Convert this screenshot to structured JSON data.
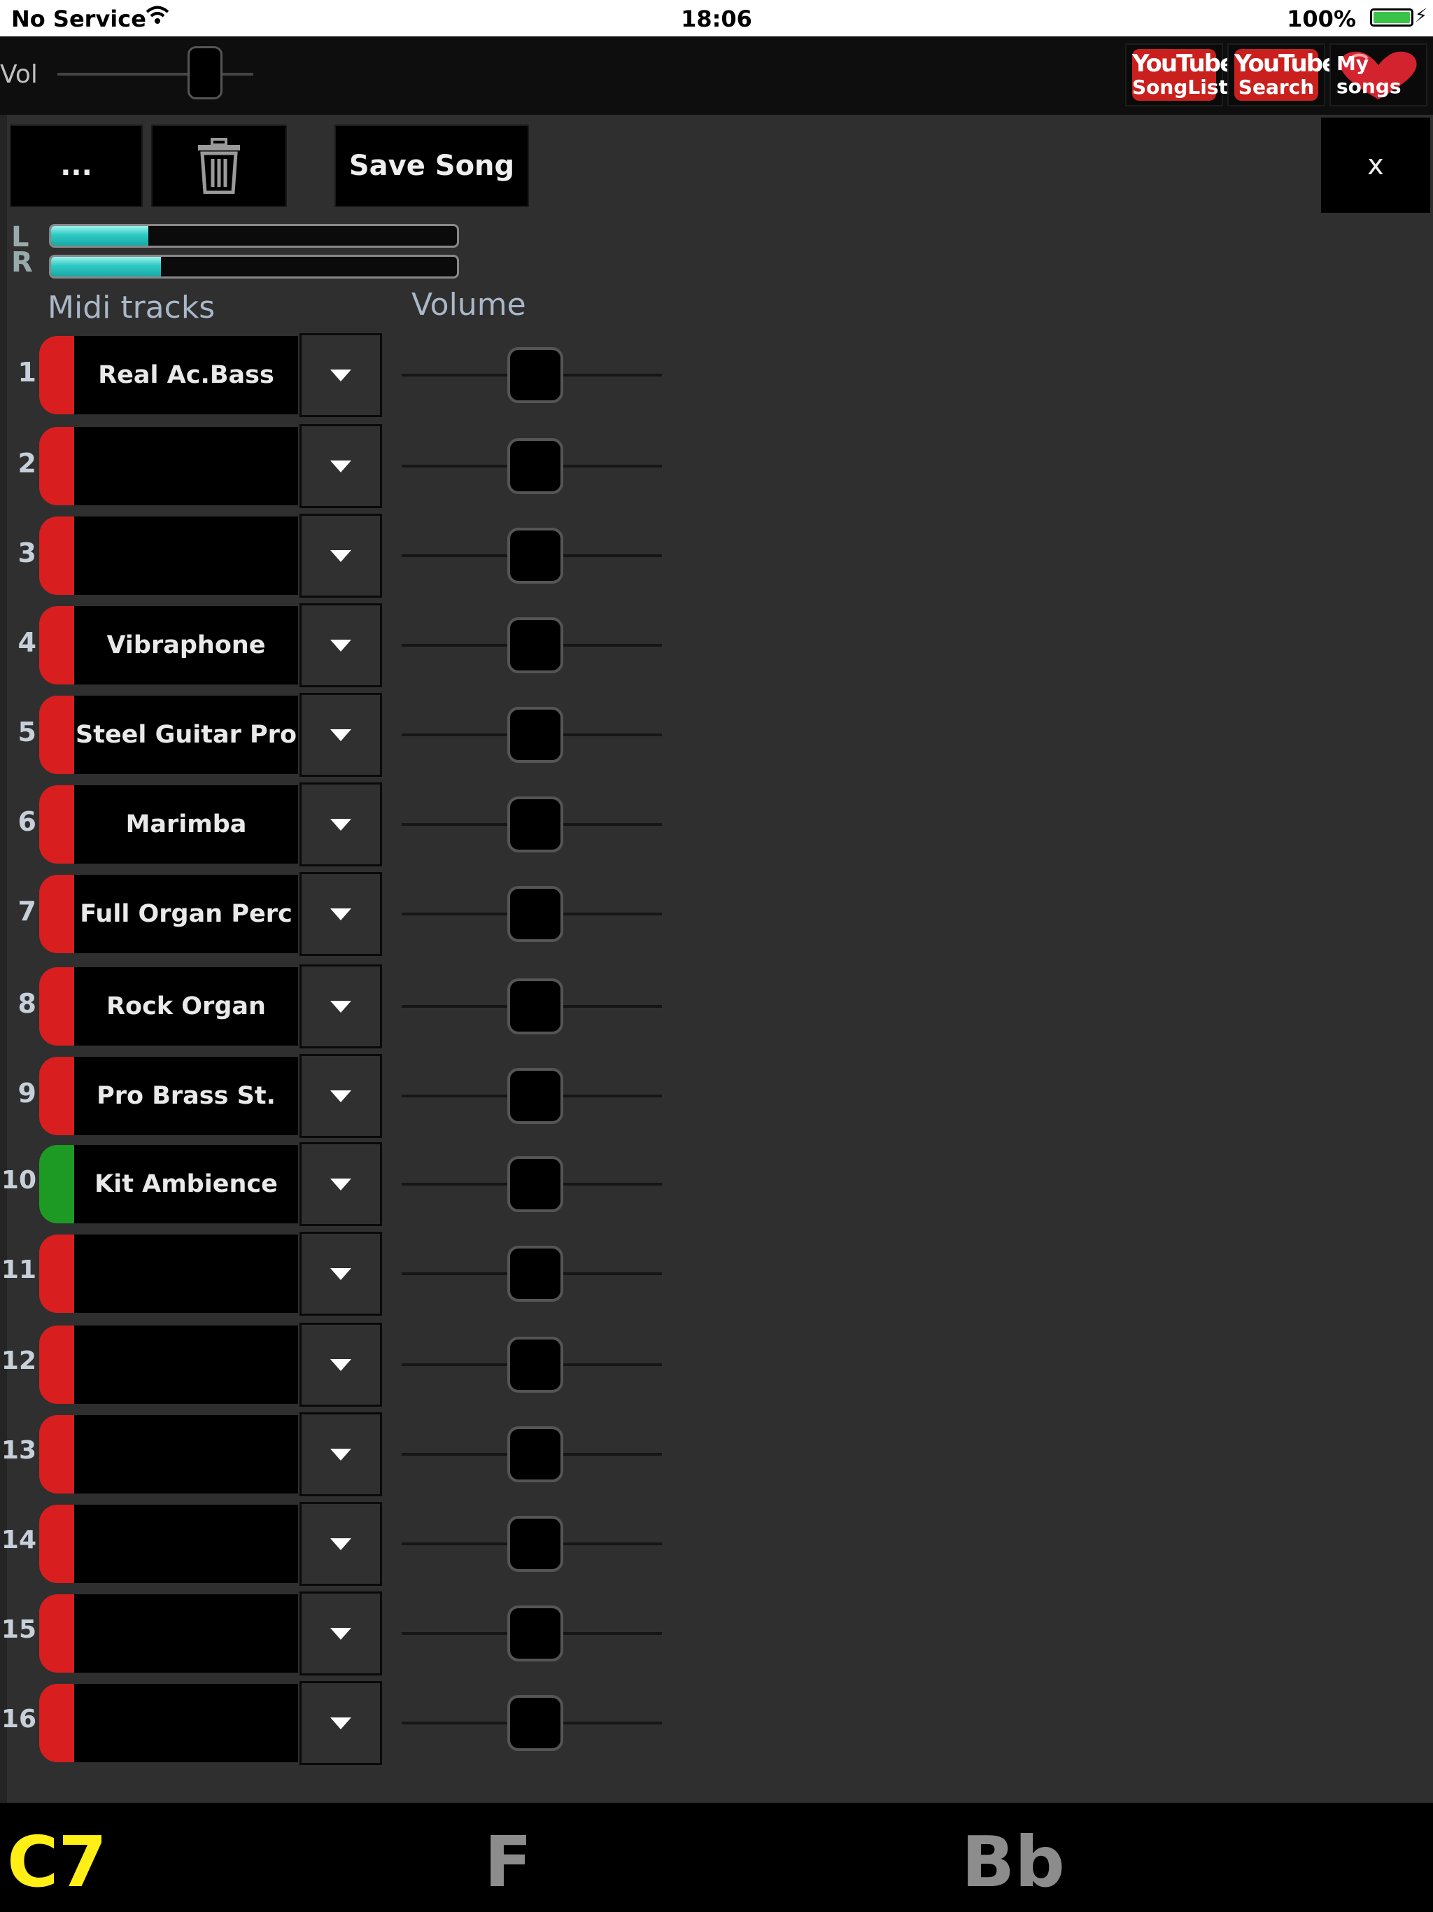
{
  "status_bar": {
    "carrier": "No Service",
    "time": "18:06",
    "battery": "100%",
    "wifi_icon": "wifi-icon",
    "battery_icon": "battery-icon"
  },
  "top_bar": {
    "vol_label": "Vol",
    "buttons": [
      {
        "logo": "YouTube",
        "label": "SongList"
      },
      {
        "logo": "YouTube",
        "label": "Search"
      },
      {
        "label": "My songs"
      }
    ]
  },
  "toolbar": {
    "more_label": "...",
    "trash_icon": "trash-icon",
    "save_label": "Save Song",
    "close_label": "x"
  },
  "meters": {
    "left_label": "L",
    "right_label": "R",
    "left_level": 0.24,
    "right_level": 0.27
  },
  "headers": {
    "tracks": "Midi tracks",
    "volume": "Volume"
  },
  "tracks": [
    {
      "number": "1",
      "name": "Real Ac.Bass",
      "color": "#d81e1e",
      "volume": 0.5
    },
    {
      "number": "2",
      "name": "",
      "color": "#d81e1e",
      "volume": 0.5
    },
    {
      "number": "3",
      "name": "",
      "color": "#d81e1e",
      "volume": 0.5
    },
    {
      "number": "4",
      "name": "Vibraphone",
      "color": "#d81e1e",
      "volume": 0.5
    },
    {
      "number": "5",
      "name": "Steel Guitar Pro",
      "color": "#d81e1e",
      "volume": 0.5
    },
    {
      "number": "6",
      "name": "Marimba",
      "color": "#d81e1e",
      "volume": 0.5
    },
    {
      "number": "7",
      "name": "Full Organ Perc",
      "color": "#d81e1e",
      "volume": 0.5
    },
    {
      "number": "8",
      "name": "Rock Organ",
      "color": "#d81e1e",
      "volume": 0.5
    },
    {
      "number": "9",
      "name": "Pro Brass St.",
      "color": "#d81e1e",
      "volume": 0.5
    },
    {
      "number": "10",
      "name": "Kit Ambience",
      "color": "#1c9a23",
      "volume": 0.5
    },
    {
      "number": "11",
      "name": "",
      "color": "#d81e1e",
      "volume": 0.5
    },
    {
      "number": "12",
      "name": "",
      "color": "#d81e1e",
      "volume": 0.5
    },
    {
      "number": "13",
      "name": "",
      "color": "#d81e1e",
      "volume": 0.5
    },
    {
      "number": "14",
      "name": "",
      "color": "#d81e1e",
      "volume": 0.5
    },
    {
      "number": "15",
      "name": "",
      "color": "#d81e1e",
      "volume": 0.5
    },
    {
      "number": "16",
      "name": "",
      "color": "#d81e1e",
      "volume": 0.5
    }
  ],
  "chords": {
    "current": "C7",
    "next": [
      "F",
      "Bb"
    ],
    "current_color": "#ffef16"
  }
}
